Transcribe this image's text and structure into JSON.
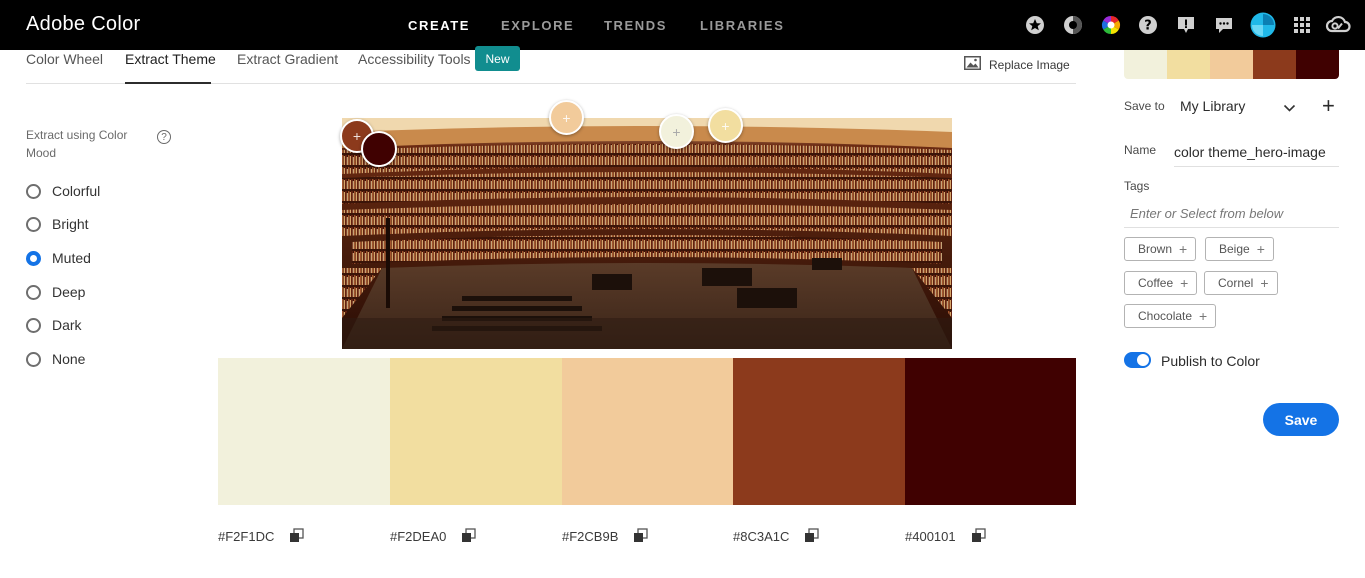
{
  "app": {
    "title": "Adobe Color"
  },
  "nav": {
    "create": "CREATE",
    "explore": "EXPLORE",
    "trends": "TRENDS",
    "libraries": "LIBRARIES"
  },
  "top_icons": [
    "star-icon",
    "contrast-icon",
    "color-wheel-icon",
    "help-icon",
    "feedback-icon",
    "chat-icon",
    "avatar",
    "apps-grid-icon",
    "creative-cloud-icon"
  ],
  "subtabs": {
    "color_wheel": "Color Wheel",
    "extract_theme": "Extract Theme",
    "extract_gradient": "Extract Gradient",
    "accessibility_tools": "Accessibility Tools",
    "new_badge": "New",
    "active": "Extract Theme"
  },
  "replace_image": "Replace Image",
  "mood": {
    "title": "Extract using Color Mood",
    "options": [
      "Colorful",
      "Bright",
      "Muted",
      "Deep",
      "Dark",
      "None"
    ],
    "selected": "Muted"
  },
  "swatches": [
    {
      "hex": "#F2F1DC",
      "color": "#F2F1DC"
    },
    {
      "hex": "#F2DEA0",
      "color": "#F2DEA0"
    },
    {
      "hex": "#F2CB9B",
      "color": "#F2CB9B"
    },
    {
      "hex": "#8C3A1C",
      "color": "#8C3A1C"
    },
    {
      "hex": "#400101",
      "color": "#400101"
    }
  ],
  "right_panel": {
    "save_to_label": "Save to",
    "library": "My Library",
    "name_label": "Name",
    "name_value": "color theme_hero-image",
    "tags_label": "Tags",
    "tags_placeholder": "Enter or Select from below",
    "tags": [
      "Brown",
      "Beige",
      "Coffee",
      "Cornel",
      "Chocolate"
    ],
    "publish_label": "Publish to Color",
    "publish_on": true,
    "save_label": "Save"
  },
  "colors": {
    "accent": "#1473e6",
    "badge": "#118d8f",
    "topbar": "#000000"
  }
}
